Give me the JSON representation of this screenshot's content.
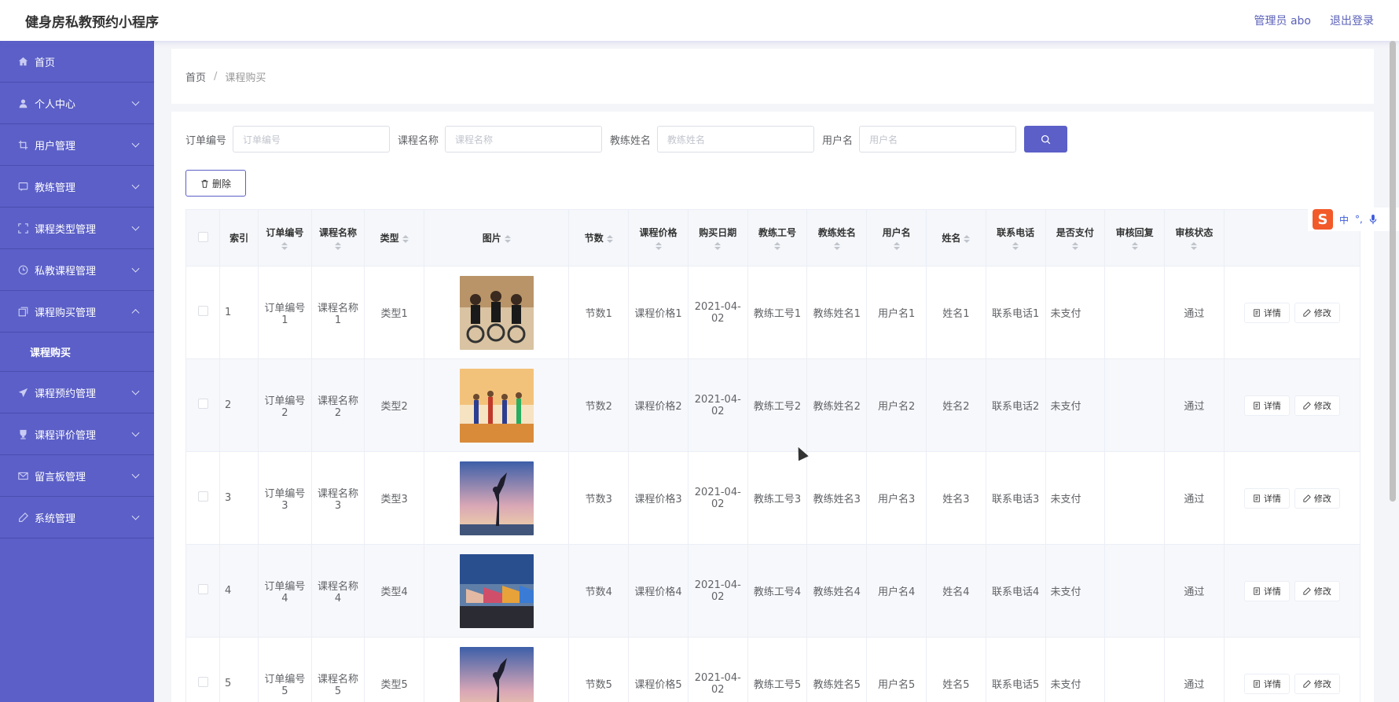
{
  "header": {
    "title": "健身房私教预约小程序",
    "user": "管理员 abo",
    "logout": "退出登录"
  },
  "sidebar": {
    "items": [
      {
        "label": "首页",
        "icon": "home-icon"
      },
      {
        "label": "个人中心",
        "icon": "user-icon"
      },
      {
        "label": "用户管理",
        "icon": "crop-icon"
      },
      {
        "label": "教练管理",
        "icon": "chat-icon"
      },
      {
        "label": "课程类型管理",
        "icon": "fullscreen-icon"
      },
      {
        "label": "私教课程管理",
        "icon": "clock-icon"
      },
      {
        "label": "课程购买管理",
        "icon": "copy-icon"
      },
      {
        "label": "课程预约管理",
        "icon": "send-icon"
      },
      {
        "label": "课程评价管理",
        "icon": "trophy-icon"
      },
      {
        "label": "留言板管理",
        "icon": "mail-icon"
      },
      {
        "label": "系统管理",
        "icon": "edit-icon"
      }
    ],
    "sub_item": "课程购买"
  },
  "breadcrumb": {
    "home": "首页",
    "separator": "/",
    "current": "课程购买"
  },
  "search": {
    "order_label": "订单编号",
    "order_placeholder": "订单编号",
    "course_label": "课程名称",
    "course_placeholder": "课程名称",
    "coach_label": "教练姓名",
    "coach_placeholder": "教练姓名",
    "user_label": "用户名",
    "user_placeholder": "用户名"
  },
  "delete_label": "删除",
  "table": {
    "headers": {
      "index": "索引",
      "order_no": "订单编号",
      "course_name": "课程名称",
      "type": "类型",
      "image": "图片",
      "sessions": "节数",
      "price": "课程价格",
      "date": "购买日期",
      "coach_no": "教练工号",
      "coach_name": "教练姓名",
      "username": "用户名",
      "name": "姓名",
      "phone": "联系电话",
      "paid": "是否支付",
      "reply": "审核回复",
      "status": "审核状态"
    },
    "rows": [
      {
        "index": "1",
        "order_no": "订单编号1",
        "course_name": "课程名称1",
        "type": "类型1",
        "sessions": "节数1",
        "price": "课程价格1",
        "date": "2021-04-02",
        "coach_no": "教练工号1",
        "coach_name": "教练姓名1",
        "username": "用户名1",
        "name": "姓名1",
        "phone": "联系电话1",
        "paid": "未支付",
        "reply": "",
        "status": "通过"
      },
      {
        "index": "2",
        "order_no": "订单编号2",
        "course_name": "课程名称2",
        "type": "类型2",
        "sessions": "节数2",
        "price": "课程价格2",
        "date": "2021-04-02",
        "coach_no": "教练工号2",
        "coach_name": "教练姓名2",
        "username": "用户名2",
        "name": "姓名2",
        "phone": "联系电话2",
        "paid": "未支付",
        "reply": "",
        "status": "通过"
      },
      {
        "index": "3",
        "order_no": "订单编号3",
        "course_name": "课程名称3",
        "type": "类型3",
        "sessions": "节数3",
        "price": "课程价格3",
        "date": "2021-04-02",
        "coach_no": "教练工号3",
        "coach_name": "教练姓名3",
        "username": "用户名3",
        "name": "姓名3",
        "phone": "联系电话3",
        "paid": "未支付",
        "reply": "",
        "status": "通过"
      },
      {
        "index": "4",
        "order_no": "订单编号4",
        "course_name": "课程名称4",
        "type": "类型4",
        "sessions": "节数4",
        "price": "课程价格4",
        "date": "2021-04-02",
        "coach_no": "教练工号4",
        "coach_name": "教练姓名4",
        "username": "用户名4",
        "name": "姓名4",
        "phone": "联系电话4",
        "paid": "未支付",
        "reply": "",
        "status": "通过"
      },
      {
        "index": "5",
        "order_no": "订单编号5",
        "course_name": "课程名称5",
        "type": "类型5",
        "sessions": "节数5",
        "price": "课程价格5",
        "date": "2021-04-02",
        "coach_no": "教练工号5",
        "coach_name": "教练姓名5",
        "username": "用户名5",
        "name": "姓名5",
        "phone": "联系电话5",
        "paid": "未支付",
        "reply": "",
        "status": "通过"
      }
    ],
    "detail_label": "详情",
    "edit_label": "修改"
  },
  "ime": {
    "lang": "中"
  },
  "colors": {
    "primary": "#5b5fc7",
    "sidebar_border": "#4a4eb0"
  }
}
